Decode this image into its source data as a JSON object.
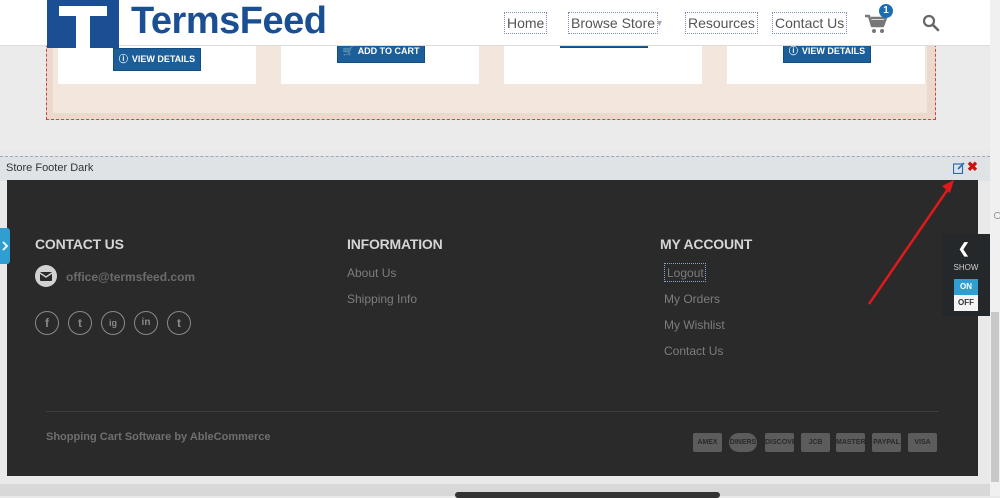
{
  "header": {
    "logo_text": "TermsFeed",
    "nav": [
      "Home",
      "Browse Store",
      "Resources",
      "Contact Us"
    ],
    "cart_count": "1"
  },
  "products": {
    "view_details": "VIEW DETAILS",
    "add_to_cart": "ADD TO CART"
  },
  "editor": {
    "section_label": "Store Footer Dark"
  },
  "footer": {
    "contact_heading": "CONTACT US",
    "email": "office@termsfeed.com",
    "social": [
      "f",
      "t",
      "ig",
      "in",
      "t"
    ],
    "information_heading": "INFORMATION",
    "information_links": [
      "About Us",
      "Shipping Info"
    ],
    "account_heading": "MY ACCOUNT",
    "account_links": [
      "Logout",
      "My Orders",
      "My Wishlist",
      "Contact Us"
    ],
    "copyright": "Shopping Cart Software by AbleCommerce",
    "payment_icons": [
      "AMEX",
      "DINERS",
      "DISCOVER",
      "JCB",
      "MASTERCARD",
      "PAYPAL",
      "VISA"
    ]
  },
  "side_panel": {
    "show_label": "SHOW",
    "on_label": "ON",
    "off_label": "OFF"
  },
  "colors": {
    "brand_blue": "#1b4f93",
    "button_blue": "#1b5e9a",
    "footer_dark": "#2a2a2a",
    "toggle_blue": "#2f9fd1",
    "close_red": "#cc1111",
    "annotation_red": "#e0191b"
  }
}
